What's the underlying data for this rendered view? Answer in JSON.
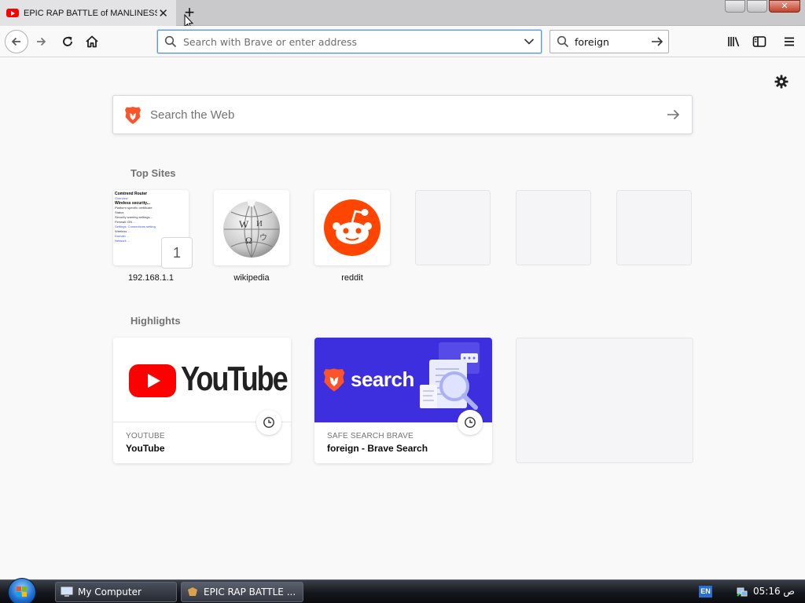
{
  "browser": {
    "tab": {
      "title": "EPIC RAP BATTLE of MANLINESS",
      "close_glyph": "✕",
      "favicon": "youtube-icon"
    },
    "new_tab_glyph": "+",
    "window_controls": {
      "close_glyph": "✕"
    },
    "url_bar": {
      "placeholder": "Search with Brave or enter address",
      "value": ""
    },
    "search_bar": {
      "value": "foreign"
    }
  },
  "newtab": {
    "web_search": {
      "placeholder": "Search the Web"
    },
    "top_sites": {
      "title": "Top Sites",
      "items": [
        {
          "label": "192.168.1.1",
          "pinned_badge": "1",
          "thumbnail_lines": [
            "Comtrend Router",
            "Overview",
            "Wireless security...",
            "Platform specific certificate",
            "Status",
            "Security warning settings...",
            "Firewall: ON ...",
            "Settings: Connections setting",
            "Wireless ...",
            "Domain ...",
            "Network ..."
          ]
        },
        {
          "label": "wikipedia"
        },
        {
          "label": "reddit"
        },
        {
          "label": ""
        },
        {
          "label": ""
        },
        {
          "label": ""
        }
      ]
    },
    "highlights": {
      "title": "Highlights",
      "items": [
        {
          "source": "YOUTUBE",
          "title": "YouTube",
          "logo_text": "YouTube"
        },
        {
          "source": "SAFE SEARCH BRAVE",
          "title": "foreign - Brave Search",
          "logo_text": "search"
        },
        {
          "source": "",
          "title": ""
        }
      ]
    }
  },
  "taskbar": {
    "buttons": [
      {
        "label": "My Computer"
      },
      {
        "label": "EPIC RAP BATTLE ..."
      }
    ],
    "language": "EN",
    "clock": "ص 05:16"
  },
  "colors": {
    "brave_orange": "#fb542b",
    "reddit_orange": "#ff4500",
    "youtube_red": "#ff0000",
    "brave_search_purple": "#3d2fde",
    "focus_blue": "#5a97e6"
  }
}
